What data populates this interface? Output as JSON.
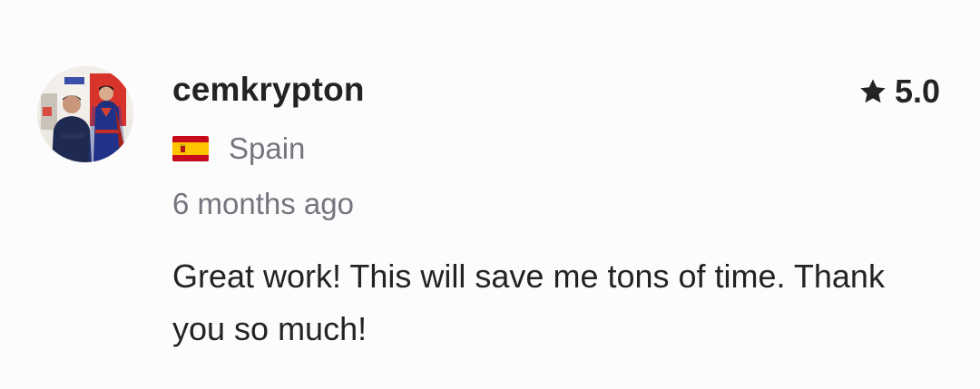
{
  "review": {
    "username": "cemkrypton",
    "rating": "5.0",
    "country": "Spain",
    "time_ago": "6 months ago",
    "text": "Great work! This will save me tons of time. Thank you so much!"
  },
  "icons": {
    "rating": "star-icon",
    "country_flag": "spain-flag-icon",
    "avatar": "user-avatar"
  },
  "colors": {
    "text_primary": "#222325",
    "text_secondary": "#74767e",
    "background": "#fcfcfc"
  }
}
